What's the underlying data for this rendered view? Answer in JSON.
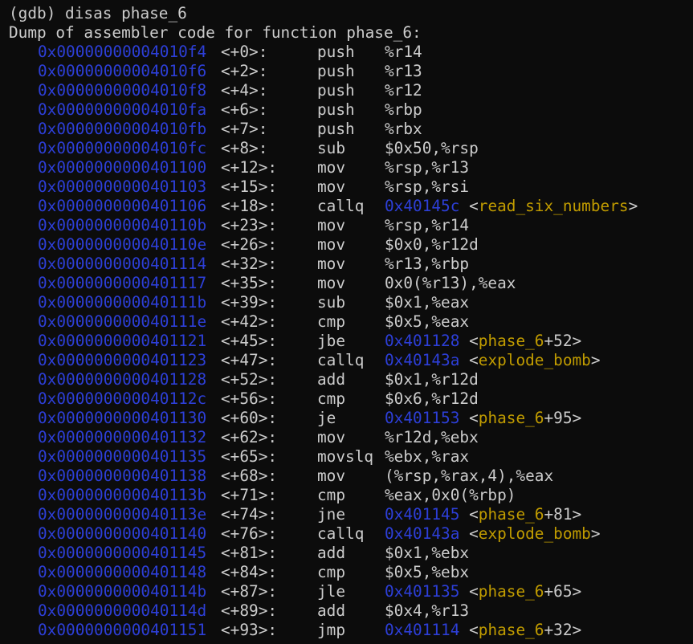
{
  "terminal": {
    "background": "#0c0c0c",
    "foreground": "#cccccc",
    "address_color": "#2d3fd8",
    "symbol_color": "#c19c00",
    "command": "(gdb) disas phase_6",
    "header": "Dump of assembler code for function phase_6:"
  },
  "rows": [
    {
      "addr": "0x00000000004010f4",
      "off": "<+0>:",
      "mn": "push",
      "ops": "%r14"
    },
    {
      "addr": "0x00000000004010f6",
      "off": "<+2>:",
      "mn": "push",
      "ops": "%r13"
    },
    {
      "addr": "0x00000000004010f8",
      "off": "<+4>:",
      "mn": "push",
      "ops": "%r12"
    },
    {
      "addr": "0x00000000004010fa",
      "off": "<+6>:",
      "mn": "push",
      "ops": "%rbp"
    },
    {
      "addr": "0x00000000004010fb",
      "off": "<+7>:",
      "mn": "push",
      "ops": "%rbx"
    },
    {
      "addr": "0x00000000004010fc",
      "off": "<+8>:",
      "mn": "sub",
      "ops": "$0x50,%rsp"
    },
    {
      "addr": "0x0000000000401100",
      "off": "<+12>:",
      "mn": "mov",
      "ops": "%rsp,%r13"
    },
    {
      "addr": "0x0000000000401103",
      "off": "<+15>:",
      "mn": "mov",
      "ops": "%rsp,%rsi"
    },
    {
      "addr": "0x0000000000401106",
      "off": "<+18>:",
      "mn": "callq",
      "target": "0x40145c",
      "sym": "read_six_numbers",
      "symoff": ""
    },
    {
      "addr": "0x000000000040110b",
      "off": "<+23>:",
      "mn": "mov",
      "ops": "%rsp,%r14"
    },
    {
      "addr": "0x000000000040110e",
      "off": "<+26>:",
      "mn": "mov",
      "ops": "$0x0,%r12d"
    },
    {
      "addr": "0x0000000000401114",
      "off": "<+32>:",
      "mn": "mov",
      "ops": "%r13,%rbp"
    },
    {
      "addr": "0x0000000000401117",
      "off": "<+35>:",
      "mn": "mov",
      "ops": "0x0(%r13),%eax"
    },
    {
      "addr": "0x000000000040111b",
      "off": "<+39>:",
      "mn": "sub",
      "ops": "$0x1,%eax"
    },
    {
      "addr": "0x000000000040111e",
      "off": "<+42>:",
      "mn": "cmp",
      "ops": "$0x5,%eax"
    },
    {
      "addr": "0x0000000000401121",
      "off": "<+45>:",
      "mn": "jbe",
      "target": "0x401128",
      "sym": "phase_6",
      "symoff": "+52"
    },
    {
      "addr": "0x0000000000401123",
      "off": "<+47>:",
      "mn": "callq",
      "target": "0x40143a",
      "sym": "explode_bomb",
      "symoff": ""
    },
    {
      "addr": "0x0000000000401128",
      "off": "<+52>:",
      "mn": "add",
      "ops": "$0x1,%r12d"
    },
    {
      "addr": "0x000000000040112c",
      "off": "<+56>:",
      "mn": "cmp",
      "ops": "$0x6,%r12d"
    },
    {
      "addr": "0x0000000000401130",
      "off": "<+60>:",
      "mn": "je",
      "target": "0x401153",
      "sym": "phase_6",
      "symoff": "+95"
    },
    {
      "addr": "0x0000000000401132",
      "off": "<+62>:",
      "mn": "mov",
      "ops": "%r12d,%ebx"
    },
    {
      "addr": "0x0000000000401135",
      "off": "<+65>:",
      "mn": "movslq",
      "ops": "%ebx,%rax"
    },
    {
      "addr": "0x0000000000401138",
      "off": "<+68>:",
      "mn": "mov",
      "ops": "(%rsp,%rax,4),%eax"
    },
    {
      "addr": "0x000000000040113b",
      "off": "<+71>:",
      "mn": "cmp",
      "ops": "%eax,0x0(%rbp)"
    },
    {
      "addr": "0x000000000040113e",
      "off": "<+74>:",
      "mn": "jne",
      "target": "0x401145",
      "sym": "phase_6",
      "symoff": "+81"
    },
    {
      "addr": "0x0000000000401140",
      "off": "<+76>:",
      "mn": "callq",
      "target": "0x40143a",
      "sym": "explode_bomb",
      "symoff": ""
    },
    {
      "addr": "0x0000000000401145",
      "off": "<+81>:",
      "mn": "add",
      "ops": "$0x1,%ebx"
    },
    {
      "addr": "0x0000000000401148",
      "off": "<+84>:",
      "mn": "cmp",
      "ops": "$0x5,%ebx"
    },
    {
      "addr": "0x000000000040114b",
      "off": "<+87>:",
      "mn": "jle",
      "target": "0x401135",
      "sym": "phase_6",
      "symoff": "+65"
    },
    {
      "addr": "0x000000000040114d",
      "off": "<+89>:",
      "mn": "add",
      "ops": "$0x4,%r13"
    },
    {
      "addr": "0x0000000000401151",
      "off": "<+93>:",
      "mn": "jmp",
      "target": "0x401114",
      "sym": "phase_6",
      "symoff": "+32"
    }
  ]
}
